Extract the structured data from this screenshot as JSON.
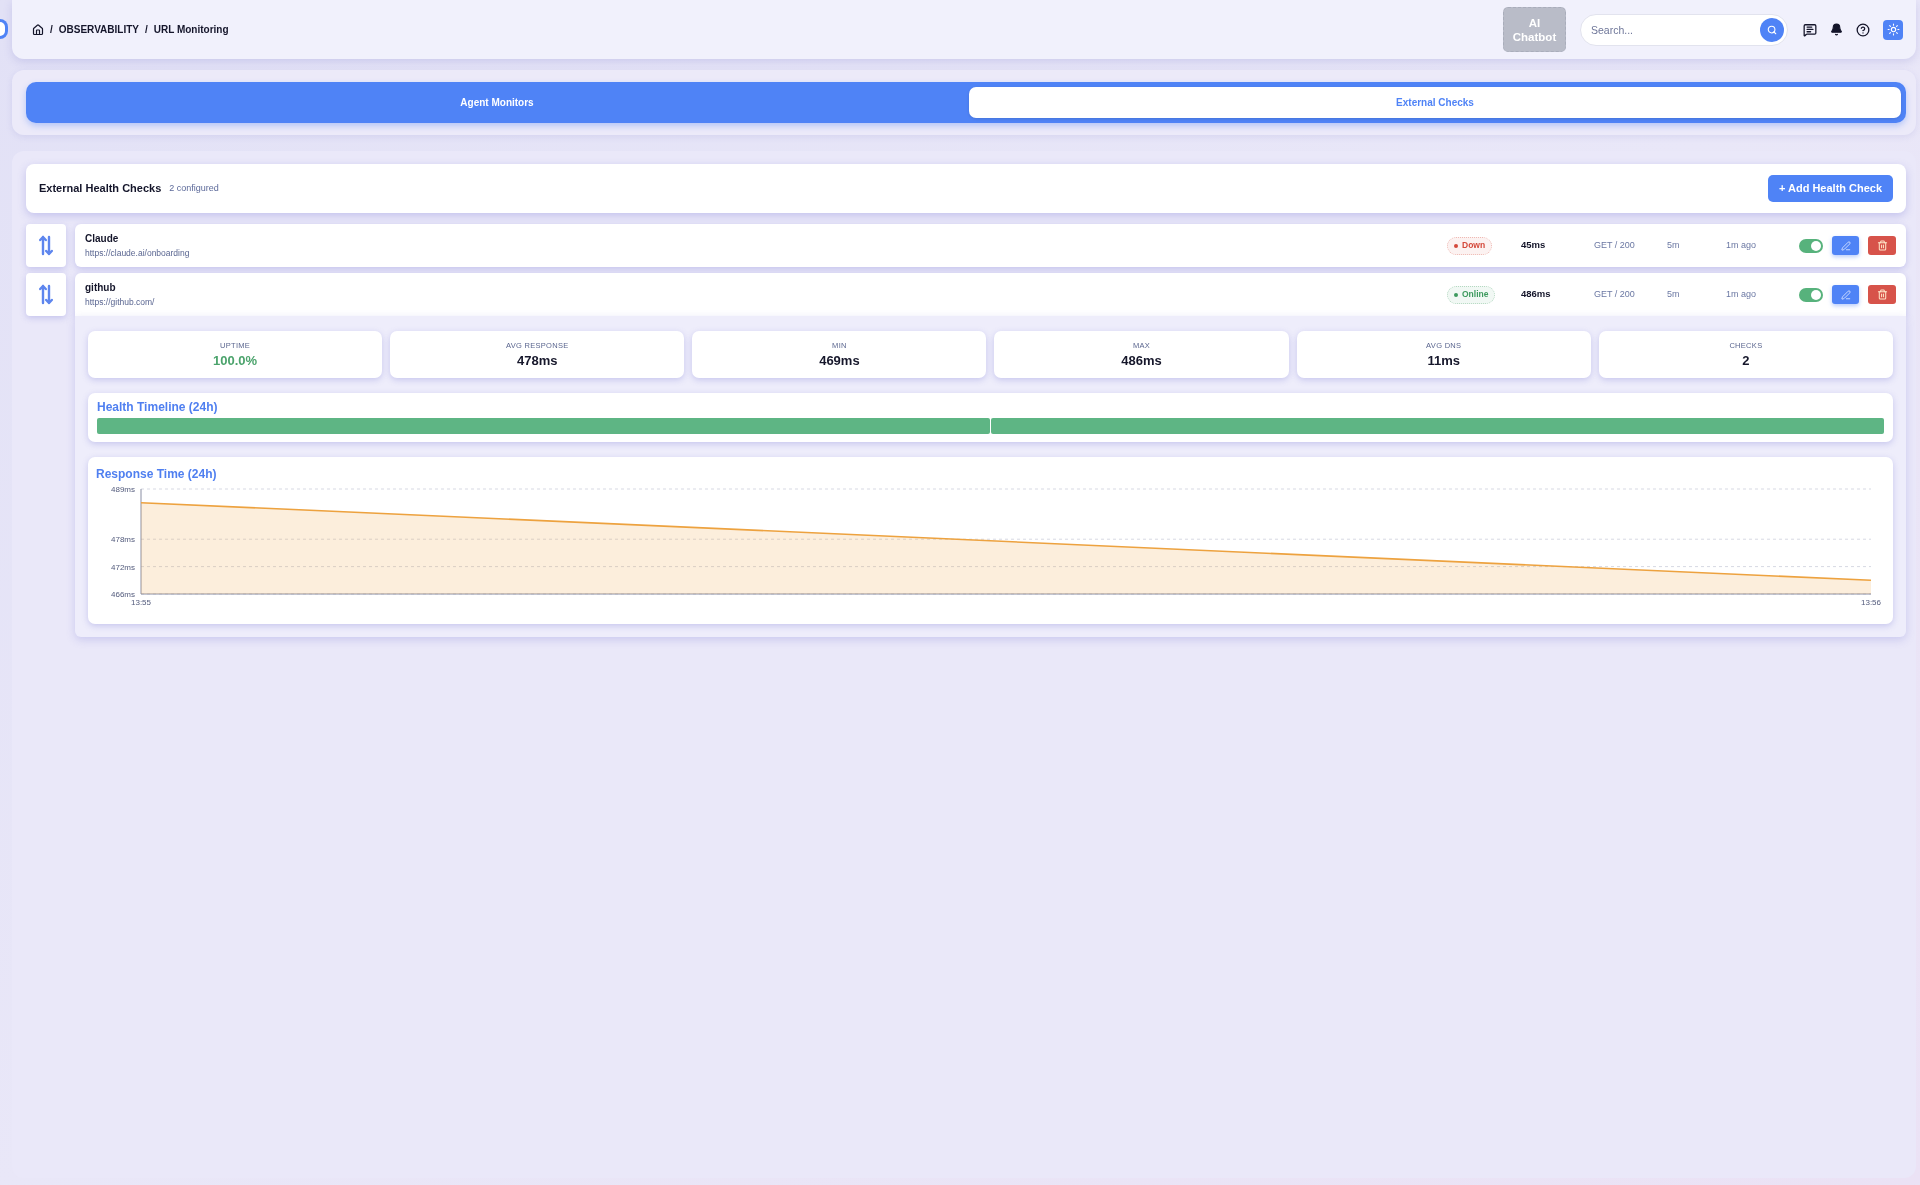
{
  "breadcrumb": [
    {
      "separator": "/",
      "label": "OBSERVABILITY"
    },
    {
      "separator": "/",
      "label": "URL Monitoring"
    }
  ],
  "header": {
    "chatbot_button": "AI Chatbot",
    "search": {
      "placeholder": "Search..."
    }
  },
  "tabs": [
    {
      "label": "Agent Monitors",
      "selected": false
    },
    {
      "label": "External Checks",
      "selected": true
    }
  ],
  "health_checks": {
    "title": "External Health Checks",
    "count": "2 configured",
    "add_button": "+ Add Health Check",
    "checks": [
      {
        "name": "Claude",
        "url": "https://claude.ai/onboarding",
        "status": "Down",
        "color": "#d4493b",
        "response_time": "45ms",
        "request": "GET / 200",
        "interval": "5m",
        "last_check": "1m ago",
        "enabled": true,
        "expanded": false
      },
      {
        "name": "github",
        "url": "https://github.com/",
        "status": "Online",
        "color": "#3d9a5e",
        "response_time": "486ms",
        "request": "GET / 200",
        "interval": "5m",
        "last_check": "1m ago",
        "enabled": true,
        "expanded": true,
        "details": {
          "stats": [
            {
              "label": "UPTIME",
              "value": "100.0%",
              "kind": "uptime"
            },
            {
              "label": "AVG RESPONSE",
              "value": "478ms",
              "kind": "metric"
            },
            {
              "label": "MIN",
              "value": "469ms",
              "kind": "metric"
            },
            {
              "label": "MAX",
              "value": "486ms",
              "kind": "metric"
            },
            {
              "label": "AVG DNS",
              "value": "11ms",
              "kind": "metric"
            },
            {
              "label": "CHECKS",
              "value": "2",
              "kind": "metric"
            }
          ],
          "timeline": {
            "title": "Health Timeline (24h)",
            "segments": [
              {
                "healthy": true
              },
              {
                "healthy": true
              }
            ]
          },
          "response_chart": {
            "chart_data": {
              "type": "area",
              "title": "Response Time (24h)",
              "x": [
                835,
                836
              ],
              "series": [
                {
                  "color": "#eda23f",
                  "values": [
                    486,
                    469
                  ]
                }
              ],
              "xlim": [
                835,
                836
              ],
              "ylim": [
                466,
                489
              ],
              "xticks": [
                {
                  "value": 835,
                  "label": "13:55"
                },
                {
                  "value": 836,
                  "label": "13:56"
                }
              ],
              "yticks": [
                {
                  "value": 466,
                  "label": "466ms"
                },
                {
                  "value": 472,
                  "label": "472ms"
                },
                {
                  "value": 478,
                  "label": "478ms"
                },
                {
                  "value": 489,
                  "label": "489ms"
                }
              ]
            }
          }
        }
      }
    ]
  }
}
